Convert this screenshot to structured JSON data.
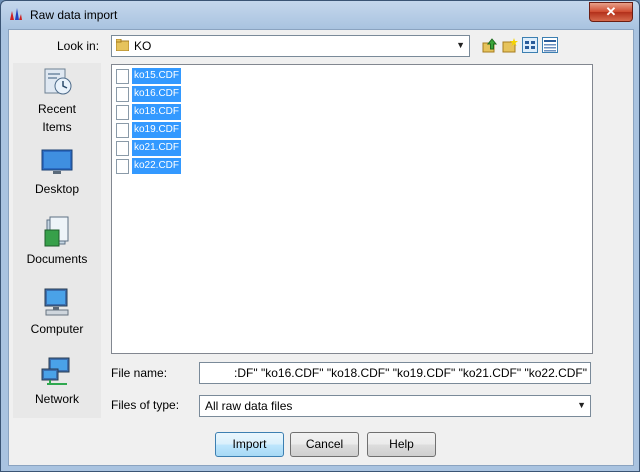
{
  "window": {
    "title": "Raw data import",
    "close_symbol": "✕"
  },
  "lookin": {
    "label": "Look in:",
    "value": "KO"
  },
  "toolbar_icons": [
    "up-folder-icon",
    "new-folder-icon",
    "list-view-icon",
    "details-view-icon"
  ],
  "places": [
    {
      "label_lines": [
        "Recent",
        "Items"
      ],
      "icon": "recent-items-icon"
    },
    {
      "label_lines": [
        "Desktop"
      ],
      "icon": "desktop-icon"
    },
    {
      "label_lines": [
        "Documents"
      ],
      "icon": "documents-icon"
    },
    {
      "label_lines": [
        "Computer"
      ],
      "icon": "computer-icon"
    },
    {
      "label_lines": [
        "Network"
      ],
      "icon": "network-icon"
    }
  ],
  "files": [
    "ko15.CDF",
    "ko16.CDF",
    "ko18.CDF",
    "ko19.CDF",
    "ko21.CDF",
    "ko22.CDF"
  ],
  "filename": {
    "label": "File name:",
    "value": ":DF\" \"ko16.CDF\" \"ko18.CDF\" \"ko19.CDF\" \"ko21.CDF\" \"ko22.CDF\""
  },
  "filetype": {
    "label": "Files of type:",
    "value": "All raw data files"
  },
  "buttons": {
    "import": "Import",
    "cancel": "Cancel",
    "help": "Help"
  }
}
